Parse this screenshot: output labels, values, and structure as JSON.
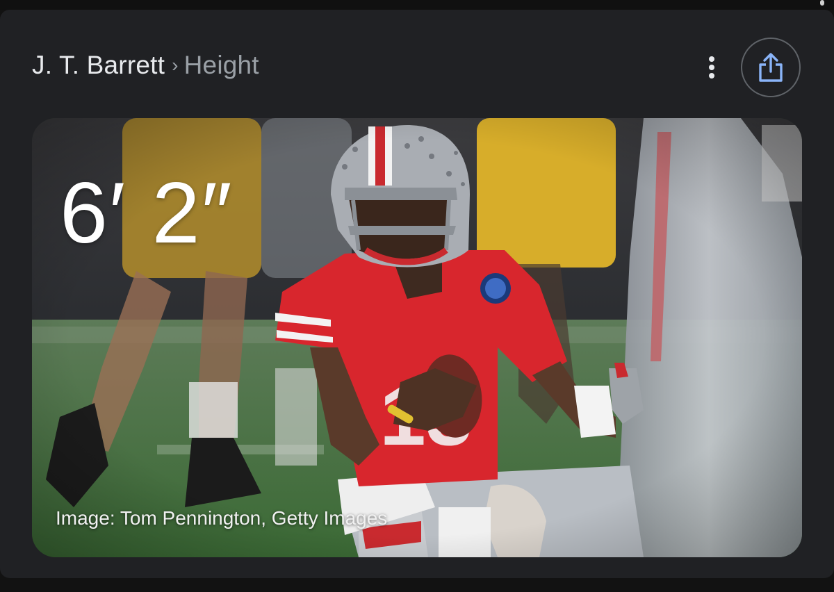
{
  "breadcrumb": {
    "entity": "J. T. Barrett",
    "separator": "›",
    "attribute": "Height"
  },
  "actions": {
    "more_icon": "more-vert-icon",
    "share_icon": "share-icon"
  },
  "answer": {
    "value": "6′ 2″",
    "image_credit": "Image: Tom Pennington, Getty Images"
  },
  "colors": {
    "background": "#121212",
    "card": "#202124",
    "primary_text": "#e8eaed",
    "secondary_text": "#9aa0a6",
    "accent": "#8ab4f8",
    "jersey_red": "#d8262d",
    "helmet_silver": "#a9adb3",
    "field_green": "#3f6a3c"
  }
}
